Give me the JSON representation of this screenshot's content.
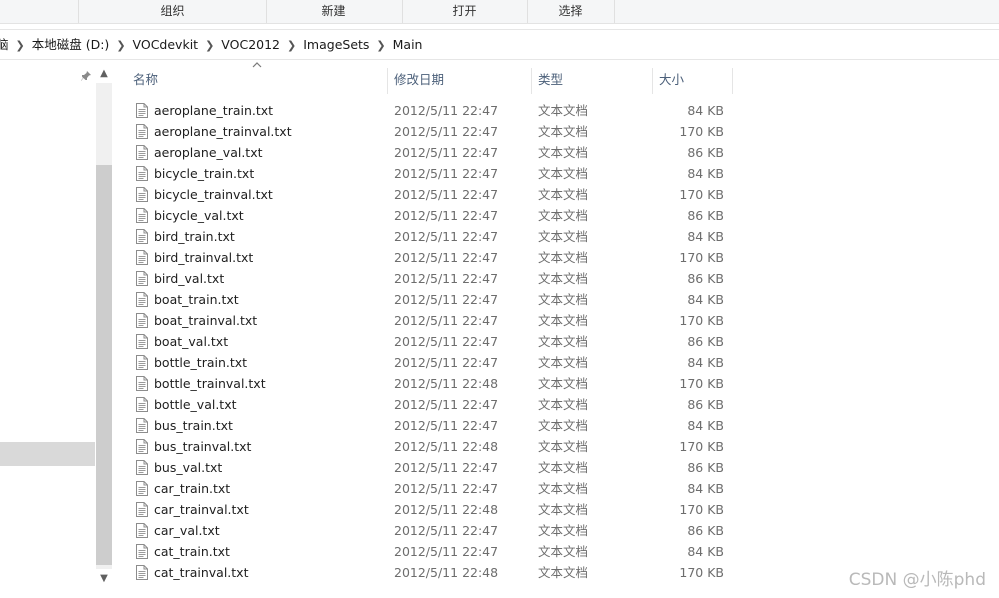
{
  "ribbon": {
    "groups": [
      "组织",
      "新建",
      "打开",
      "选择"
    ]
  },
  "address": {
    "crumbs": [
      "脑",
      "本地磁盘 (D:)",
      "VOCdevkit",
      "VOC2012",
      "ImageSets",
      "Main"
    ]
  },
  "columns": {
    "name": "名称",
    "date": "修改日期",
    "type": "类型",
    "size": "大小"
  },
  "files": [
    {
      "name": "aeroplane_train.txt",
      "date": "2012/5/11 22:47",
      "type": "文本文档",
      "size": "84 KB"
    },
    {
      "name": "aeroplane_trainval.txt",
      "date": "2012/5/11 22:47",
      "type": "文本文档",
      "size": "170 KB"
    },
    {
      "name": "aeroplane_val.txt",
      "date": "2012/5/11 22:47",
      "type": "文本文档",
      "size": "86 KB"
    },
    {
      "name": "bicycle_train.txt",
      "date": "2012/5/11 22:47",
      "type": "文本文档",
      "size": "84 KB"
    },
    {
      "name": "bicycle_trainval.txt",
      "date": "2012/5/11 22:47",
      "type": "文本文档",
      "size": "170 KB"
    },
    {
      "name": "bicycle_val.txt",
      "date": "2012/5/11 22:47",
      "type": "文本文档",
      "size": "86 KB"
    },
    {
      "name": "bird_train.txt",
      "date": "2012/5/11 22:47",
      "type": "文本文档",
      "size": "84 KB"
    },
    {
      "name": "bird_trainval.txt",
      "date": "2012/5/11 22:47",
      "type": "文本文档",
      "size": "170 KB"
    },
    {
      "name": "bird_val.txt",
      "date": "2012/5/11 22:47",
      "type": "文本文档",
      "size": "86 KB"
    },
    {
      "name": "boat_train.txt",
      "date": "2012/5/11 22:47",
      "type": "文本文档",
      "size": "84 KB"
    },
    {
      "name": "boat_trainval.txt",
      "date": "2012/5/11 22:47",
      "type": "文本文档",
      "size": "170 KB"
    },
    {
      "name": "boat_val.txt",
      "date": "2012/5/11 22:47",
      "type": "文本文档",
      "size": "86 KB"
    },
    {
      "name": "bottle_train.txt",
      "date": "2012/5/11 22:47",
      "type": "文本文档",
      "size": "84 KB"
    },
    {
      "name": "bottle_trainval.txt",
      "date": "2012/5/11 22:48",
      "type": "文本文档",
      "size": "170 KB"
    },
    {
      "name": "bottle_val.txt",
      "date": "2012/5/11 22:47",
      "type": "文本文档",
      "size": "86 KB"
    },
    {
      "name": "bus_train.txt",
      "date": "2012/5/11 22:47",
      "type": "文本文档",
      "size": "84 KB"
    },
    {
      "name": "bus_trainval.txt",
      "date": "2012/5/11 22:48",
      "type": "文本文档",
      "size": "170 KB"
    },
    {
      "name": "bus_val.txt",
      "date": "2012/5/11 22:47",
      "type": "文本文档",
      "size": "86 KB"
    },
    {
      "name": "car_train.txt",
      "date": "2012/5/11 22:47",
      "type": "文本文档",
      "size": "84 KB"
    },
    {
      "name": "car_trainval.txt",
      "date": "2012/5/11 22:48",
      "type": "文本文档",
      "size": "170 KB"
    },
    {
      "name": "car_val.txt",
      "date": "2012/5/11 22:47",
      "type": "文本文档",
      "size": "86 KB"
    },
    {
      "name": "cat_train.txt",
      "date": "2012/5/11 22:47",
      "type": "文本文档",
      "size": "84 KB"
    },
    {
      "name": "cat_trainval.txt",
      "date": "2012/5/11 22:48",
      "type": "文本文档",
      "size": "170 KB"
    }
  ],
  "watermark": "CSDN @小陈phd",
  "colors": {
    "header_text": "#4c607a",
    "nav_selected": "#d9d9d9",
    "detail_text": "#6d6d6d"
  }
}
